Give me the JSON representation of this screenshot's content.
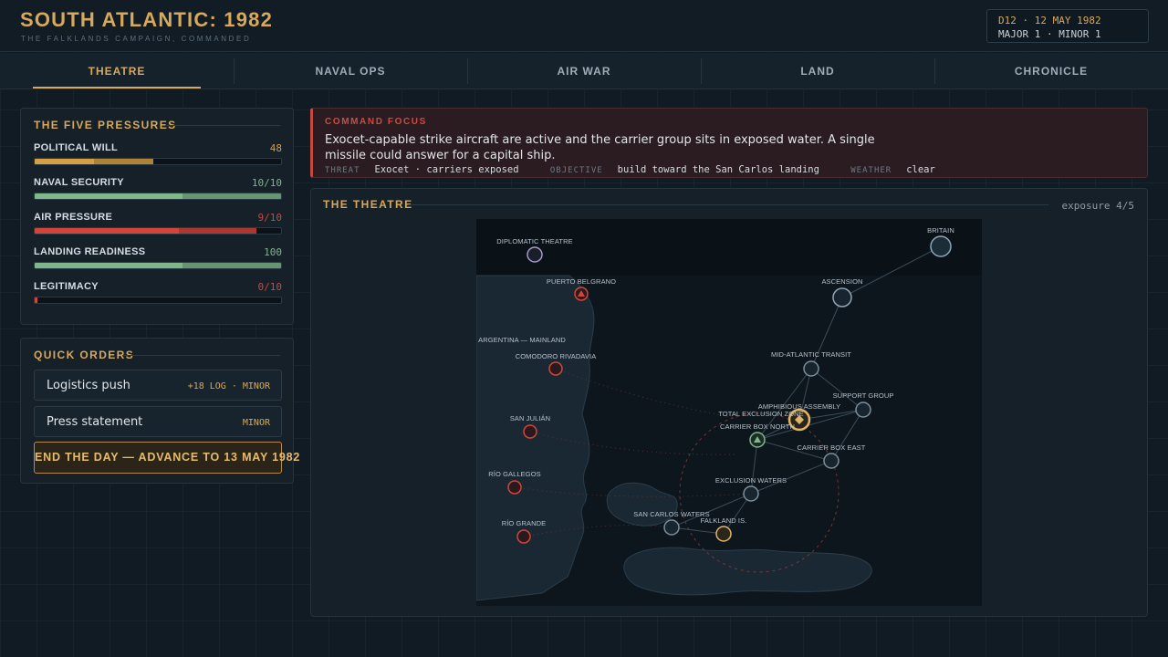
{
  "header": {
    "title": "SOUTH ATLANTIC: 1982",
    "subtitle": "THE FALKLANDS CAMPAIGN, COMMANDED",
    "day_line": "D12 · 12 MAY 1982",
    "events_line": "MAJOR 1 · MINOR 1"
  },
  "tabs": [
    {
      "label": "THEATRE",
      "active": true
    },
    {
      "label": "NAVAL OPS",
      "active": false
    },
    {
      "label": "AIR WAR",
      "active": false
    },
    {
      "label": "LAND",
      "active": false
    },
    {
      "label": "CHRONICLE",
      "active": false
    }
  ],
  "pressures": {
    "title": "THE FIVE PRESSURES",
    "items": [
      {
        "label": "POLITICAL WILL",
        "value": "48",
        "fraction": 0.48,
        "color": "#d4a043"
      },
      {
        "label": "NAVAL SECURITY",
        "value": "10/10",
        "fraction": 1.0,
        "color": "#7fb68a"
      },
      {
        "label": "AIR PRESSURE",
        "value": "9/10",
        "fraction": 0.9,
        "color": "#d2453a"
      },
      {
        "label": "LANDING READINESS",
        "value": "100",
        "fraction": 1.0,
        "color": "#7fb68a"
      },
      {
        "label": "LEGITIMACY",
        "value": "0/10",
        "fraction": 0.0,
        "color": "#d2453a"
      }
    ]
  },
  "quick_orders": {
    "title": "QUICK ORDERS",
    "items": [
      {
        "label": "Logistics push",
        "tag": "+18 LOG · MINOR"
      },
      {
        "label": "Press statement",
        "tag": "MINOR"
      }
    ],
    "end_day_label": "END THE DAY — ADVANCE TO 13 MAY 1982"
  },
  "command_focus": {
    "title": "COMMAND FOCUS",
    "text": "Exocet-capable strike aircraft are active and the carrier group sits in exposed water. A single missile could answer for a capital ship.",
    "threat_label": "THREAT",
    "threat_value": "Exocet · carriers exposed",
    "objective_label": "OBJECTIVE",
    "objective_value": "build toward the San Carlos landing",
    "weather_label": "WEATHER",
    "weather_value": "clear"
  },
  "theatre": {
    "title": "THE THEATRE",
    "exposure": "exposure 4/5",
    "colors": {
      "enemy": "#d2453a",
      "friendly": "#8fa6b5",
      "diplomatic": "#a99ac9",
      "selected": "#e0b56a",
      "secure": "#7fb68a"
    },
    "nodes": [
      {
        "id": "britain",
        "label": "BRITAIN",
        "side": "friendly"
      },
      {
        "id": "ascension",
        "label": "ASCENSION",
        "side": "friendly"
      },
      {
        "id": "diplomatic",
        "label": "DIPLOMATIC THEATRE",
        "side": "diplomatic"
      },
      {
        "id": "puerto-belgrano",
        "label": "PUERTO BELGRANO",
        "side": "enemy"
      },
      {
        "id": "argentina-mainland",
        "label": "ARGENTINA — MAINLAND",
        "side": "region"
      },
      {
        "id": "comodoro",
        "label": "COMODORO RIVADAVIA",
        "side": "enemy"
      },
      {
        "id": "san-julian",
        "label": "SAN JULIÁN",
        "side": "enemy"
      },
      {
        "id": "rio-gallegos",
        "label": "RÍO GALLEGOS",
        "side": "enemy"
      },
      {
        "id": "rio-grande",
        "label": "RÍO GRANDE",
        "side": "enemy"
      },
      {
        "id": "mid-atlantic",
        "label": "MID-ATLANTIC TRANSIT",
        "side": "friendly"
      },
      {
        "id": "support-group",
        "label": "SUPPORT GROUP",
        "side": "friendly"
      },
      {
        "id": "amphibious",
        "label": "AMPHIBIOUS ASSEMBLY",
        "side": "selected"
      },
      {
        "id": "tez",
        "label": "TOTAL EXCLUSION ZONE",
        "side": "region"
      },
      {
        "id": "carrier-north",
        "label": "CARRIER BOX NORTH",
        "side": "secure"
      },
      {
        "id": "carrier-east",
        "label": "CARRIER BOX EAST",
        "side": "friendly"
      },
      {
        "id": "exclusion-waters",
        "label": "EXCLUSION WATERS",
        "side": "friendly"
      },
      {
        "id": "san-carlos",
        "label": "SAN CARLOS WATERS",
        "side": "friendly"
      },
      {
        "id": "falkland",
        "label": "FALKLAND IS.",
        "side": "objective"
      }
    ]
  }
}
